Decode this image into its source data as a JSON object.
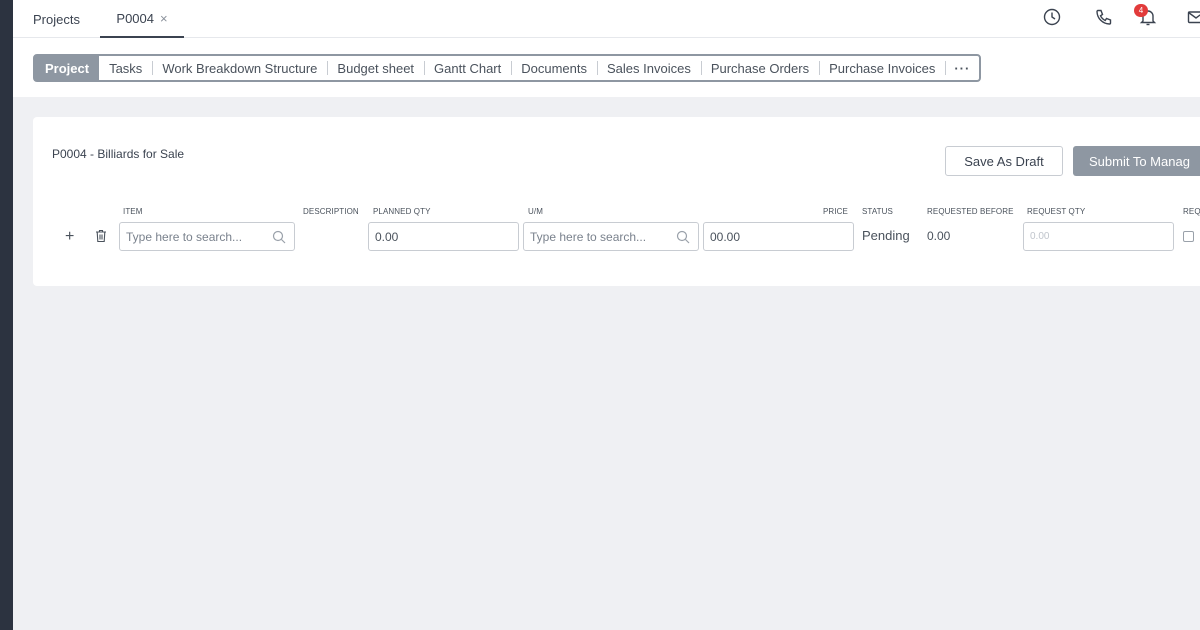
{
  "topbar": {
    "tabs": [
      {
        "label": "Projects"
      },
      {
        "label": "P0004",
        "close": "×"
      }
    ],
    "notifications_count": "4",
    "icons": [
      "clock-icon",
      "phone-icon",
      "bell-icon",
      "mail-icon"
    ]
  },
  "nav_tabs": [
    {
      "label": "Project",
      "active": true
    },
    {
      "label": "Tasks"
    },
    {
      "label": "Work Breakdown Structure"
    },
    {
      "label": "Budget sheet"
    },
    {
      "label": "Gantt Chart"
    },
    {
      "label": "Documents"
    },
    {
      "label": "Sales Invoices"
    },
    {
      "label": "Purchase Orders"
    },
    {
      "label": "Purchase Invoices"
    },
    {
      "label": "···"
    }
  ],
  "form": {
    "title": "P0004 - Billiards for Sale",
    "save_draft_label": "Save As Draft",
    "submit_label": "Submit To Manag",
    "columns": {
      "item": "ITEM",
      "description": "DESCRIPTION",
      "planned_qty": "PLANNED QTY",
      "um": "U/M",
      "price": "PRICE",
      "status": "STATUS",
      "requested_before": "REQUESTED BEFORE",
      "request_qty": "REQUEST QTY",
      "req": "REQ"
    },
    "row": {
      "add": "+",
      "item_placeholder": "Type here to search...",
      "planned_qty": "0.00",
      "um_placeholder": "Type here to search...",
      "price": "00.00",
      "status": "Pending",
      "requested_before": "0.00",
      "request_qty_placeholder": "0.00"
    }
  },
  "colors": {
    "accent": "#8e97a2",
    "badge": "#e23b3b",
    "sidebar": "#2c3340"
  }
}
